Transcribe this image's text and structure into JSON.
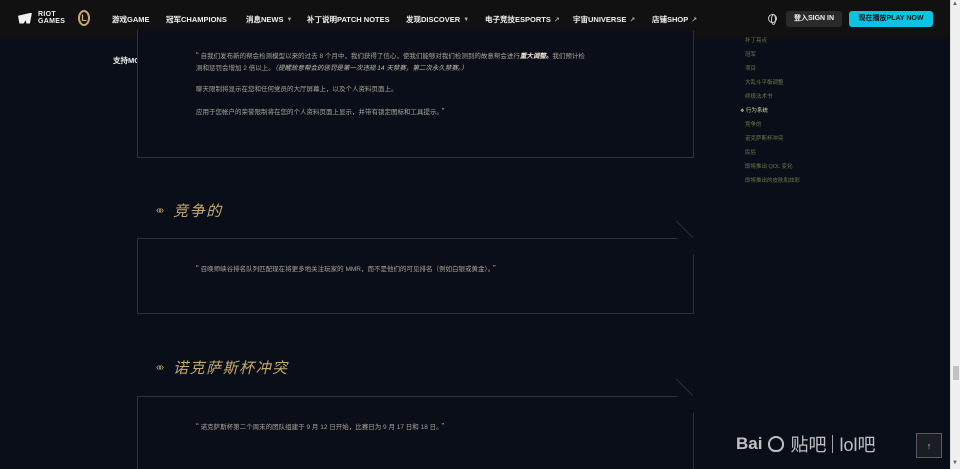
{
  "nav": {
    "riot_logo_line1": "RIOT",
    "riot_logo_line2": "GAMES",
    "lol_logo": "L",
    "items": [
      {
        "label": "游戏GAME"
      },
      {
        "label": "冠军CHAMPIONS"
      },
      {
        "label": "消息NEWS"
      },
      {
        "label": "补丁说明PATCH NOTES"
      },
      {
        "label": "发现DISCOVER"
      },
      {
        "label": "电子竞技ESPORTS"
      },
      {
        "label": "宇宙UNIVERSE"
      },
      {
        "label": "店铺SHOP"
      }
    ],
    "more_label": "支持MORE",
    "signin_label": "登入SIGN IN",
    "play_label": "现在播放PLAY NOW"
  },
  "content": {
    "panel1": {
      "quote_open": "“",
      "line1_a": "自我们发布新的帮会检测模型以来的过去 8 个月中，我们获得了信心，使我们能够对我们检测到的故意帮会进行",
      "line1_bold": "重大调整。",
      "line1_b": "我们预计检",
      "line2_a": "测和惩罚会增加 2 倍以上。",
      "line2_em": "（提醒故意帮会的惩罚是第一次违规 14 天禁赛，第二次永久禁赛。）",
      "line3": "聊天限制将显示在您和任何党员的大厅屏幕上，以及个人资料页面上。",
      "line4": "应用于您帐户的荣誉限制将在您的个人资料页面上显示，并带有锁定图标和工具提示。",
      "quote_close": "”"
    },
    "section2_title": "竞争的",
    "panel2": {
      "quote_open": "“",
      "text": "召唤师峡谷排名队列匹配现在将更多地关注玩家的 MMR，而不是他们的可见排名（例如白银或黄金）。",
      "quote_close": "”"
    },
    "section3_title": "诺克萨斯杯冲突",
    "panel3": {
      "quote_open": "“",
      "text": "诺克萨斯杯第二个周末的团队组建于 9 月 12 日开始，比赛日为 9 月 17 日和 18 日。",
      "quote_close": "”"
    }
  },
  "toc": {
    "items": [
      {
        "label": "补丁亮点"
      },
      {
        "label": "冠军"
      },
      {
        "label": "项目"
      },
      {
        "label": "大乱斗平衡调整"
      },
      {
        "label": "终极法术书"
      },
      {
        "label": "行为系统"
      },
      {
        "label": "竞争的"
      },
      {
        "label": "诺克萨斯杯冲突"
      },
      {
        "label": "民俗"
      },
      {
        "label": "即将推出 QOL 变化"
      },
      {
        "label": "即将推出的皮肤和炫彩"
      }
    ]
  },
  "watermark": {
    "brand": "Bai",
    "brand2": "贴吧",
    "forum": "lol吧"
  },
  "to_top_label": "↑",
  "colors": {
    "background": "#0a0e19",
    "gold": "#c8aa6e",
    "play_button": "#0bc4e2",
    "nav_bg": "#111111"
  }
}
